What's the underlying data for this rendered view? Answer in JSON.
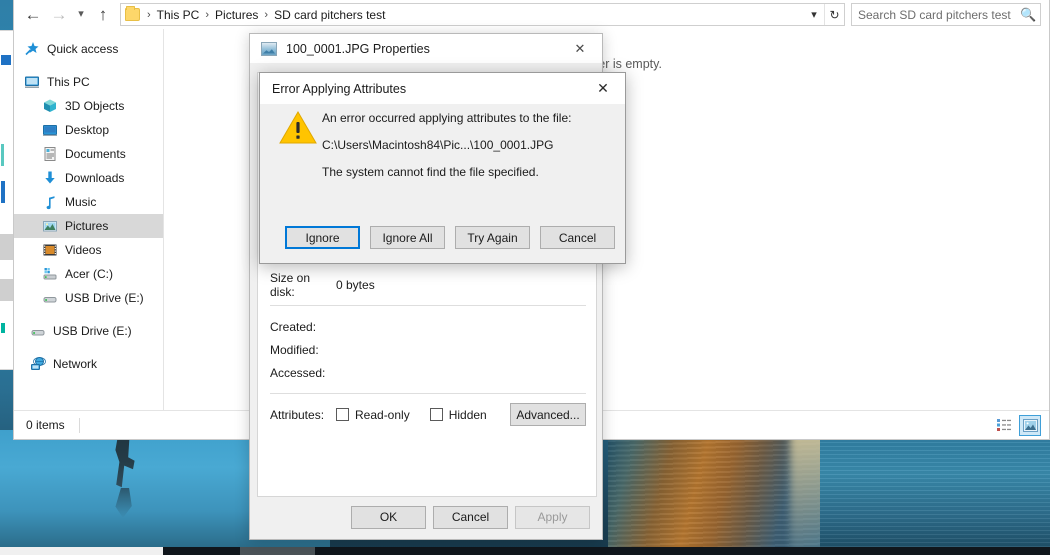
{
  "window": {
    "nav": {
      "back_icon": "arrow-left-icon",
      "forward_icon": "arrow-right-icon",
      "history_icon": "chevron-down-icon",
      "up_icon": "arrow-up-icon"
    },
    "breadcrumb": {
      "folder_icon": "folder-icon",
      "items": [
        "This PC",
        "Pictures",
        "SD card pitchers test"
      ],
      "separator": "›",
      "dropdown_icon": "chevron-down-icon",
      "refresh_icon": "refresh-icon"
    },
    "search": {
      "placeholder": "Search SD card pitchers test",
      "icon": "search-icon"
    },
    "content": {
      "empty_message": "This folder is empty."
    },
    "status": {
      "item_count": "0 items",
      "view_details_icon": "details-view-icon",
      "view_large_icons_icon": "large-icons-view-icon"
    }
  },
  "sidebar": {
    "items": [
      {
        "label": "Quick access",
        "icon": "pin-star-icon",
        "indent": 0,
        "selected": false
      },
      {
        "label": "This PC",
        "icon": "monitor-icon",
        "indent": 0,
        "selected": false
      },
      {
        "label": "3D Objects",
        "icon": "cube-icon",
        "indent": 1,
        "selected": false
      },
      {
        "label": "Desktop",
        "icon": "desktop-icon",
        "indent": 1,
        "selected": false
      },
      {
        "label": "Documents",
        "icon": "document-icon",
        "indent": 1,
        "selected": false
      },
      {
        "label": "Downloads",
        "icon": "download-arrow-icon",
        "indent": 1,
        "selected": false
      },
      {
        "label": "Music",
        "icon": "music-note-icon",
        "indent": 1,
        "selected": false
      },
      {
        "label": "Pictures",
        "icon": "picture-icon",
        "indent": 1,
        "selected": true
      },
      {
        "label": "Videos",
        "icon": "video-icon",
        "indent": 1,
        "selected": false
      },
      {
        "label": "Acer (C:)",
        "icon": "hard-drive-icon",
        "indent": 1,
        "selected": false
      },
      {
        "label": "USB Drive (E:)",
        "icon": "usb-drive-icon",
        "indent": 1,
        "selected": false
      },
      {
        "label": "USB Drive (E:)",
        "icon": "usb-drive-icon",
        "indent": 2,
        "selected": false
      },
      {
        "label": "Network",
        "icon": "network-icon",
        "indent": 2,
        "selected": false
      }
    ]
  },
  "properties_dialog": {
    "title": "100_0001.JPG Properties",
    "icon": "image-file-icon",
    "close_icon": "close-icon",
    "rows": [
      {
        "label": "Size on disk:",
        "value": "0 bytes"
      },
      {
        "label": "Created:",
        "value": ""
      },
      {
        "label": "Modified:",
        "value": ""
      },
      {
        "label": "Accessed:",
        "value": ""
      }
    ],
    "attributes": {
      "label": "Attributes:",
      "readonly_label": "Read-only",
      "readonly_checked": false,
      "hidden_label": "Hidden",
      "hidden_checked": false,
      "advanced_label": "Advanced..."
    },
    "footer": {
      "ok_label": "OK",
      "cancel_label": "Cancel",
      "apply_label": "Apply",
      "apply_disabled": true
    }
  },
  "error_dialog": {
    "title": "Error Applying Attributes",
    "close_icon": "close-icon",
    "warning_icon": "warning-triangle-icon",
    "message_lines": [
      "An error occurred applying attributes to the file:",
      "C:\\Users\\Macintosh84\\Pic...\\100_0001.JPG",
      "The system cannot find the file specified."
    ],
    "buttons": [
      {
        "label": "Ignore",
        "default": true
      },
      {
        "label": "Ignore All",
        "default": false
      },
      {
        "label": "Try Again",
        "default": false
      },
      {
        "label": "Cancel",
        "default": false
      }
    ]
  },
  "colors": {
    "accent": "#0078d7",
    "warning": "#ffc400",
    "selection": "#d8d8d8"
  }
}
